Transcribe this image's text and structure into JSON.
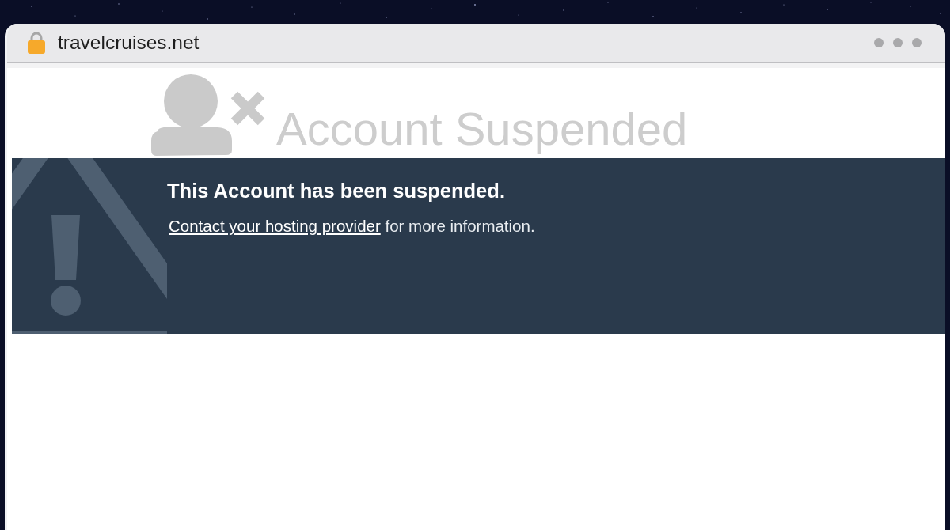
{
  "browser": {
    "url": "travelcruises.net"
  },
  "page": {
    "title": "Account Suspended",
    "notice": {
      "heading": "This Account has been suspended.",
      "link": "Contact your hosting provider",
      "text": "for more information."
    }
  }
}
